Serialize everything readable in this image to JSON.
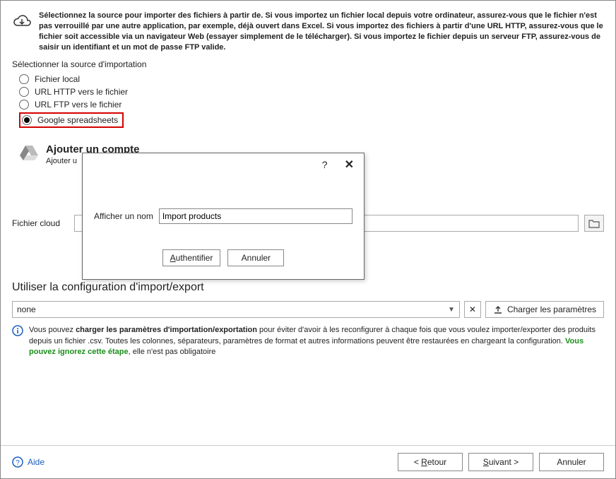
{
  "top_info": "Sélectionnez la source pour importer des fichiers à partir de. Si vous importez un fichier local depuis votre ordinateur, assurez-vous que le fichier n'est pas verrouillé par une autre application, par exemple, déjà ouvert dans Excel. Si vous importez des fichiers à partir d'une URL HTTP, assurez-vous que le fichier soit accessible via un navigateur Web (essayer simplement de le télécharger). Si vous importez le fichier depuis un serveur FTP, assurez-vous de saisir un identifiant et un mot de passe FTP valide.",
  "source": {
    "label": "Sélectionner la source d'importation",
    "options": [
      "Fichier local",
      "URL HTTP vers le fichier",
      "URL FTP vers le fichier",
      "Google spreadsheets"
    ]
  },
  "account": {
    "title": "Ajouter un compte",
    "subtitle": "Ajouter u"
  },
  "dialog": {
    "help": "?",
    "label": "Afficher un nom",
    "value": "Import products",
    "authenticate": "Authentifier",
    "cancel": "Annuler"
  },
  "cloud": {
    "label": "Fichier cloud"
  },
  "config": {
    "title": "Utiliser la configuration d'import/export",
    "selected": "none",
    "load_label": "Charger les paramètres"
  },
  "info": {
    "prefix": "Vous pouvez ",
    "bold1": "charger les paramètres d'importation/exportation",
    "mid": " pour éviter d'avoir à les reconfigurer à chaque fois que vous voulez importer/exporter des produits depuis un fichier .csv. Toutes les colonnes, séparateurs, paramètres de format et autres informations peuvent être restaurées en chargeant la configuration. ",
    "green": "Vous pouvez ignorez cette étape",
    "suffix": ", elle n'est pas obligatoire"
  },
  "footer": {
    "help": "Aide",
    "back": "Retour",
    "back_prefix": "< ",
    "next": "Suivant",
    "next_suffix": " >",
    "cancel": "Annuler"
  }
}
